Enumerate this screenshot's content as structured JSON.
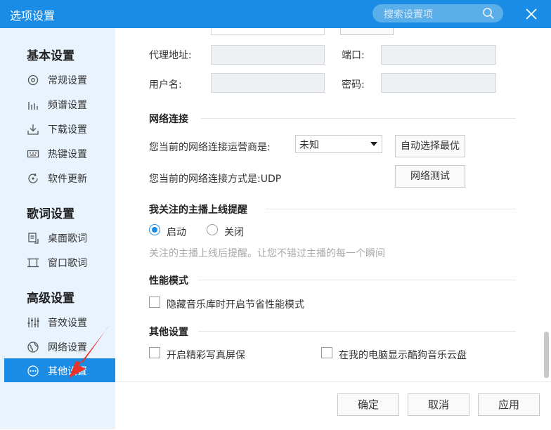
{
  "window": {
    "title": "选项设置"
  },
  "search": {
    "placeholder": "搜索设置项"
  },
  "sidebar": {
    "basic": {
      "heading": "基本设置",
      "items": [
        {
          "label": "常规设置",
          "icon": "gear-icon"
        },
        {
          "label": "频谱设置",
          "icon": "spectrum-icon"
        },
        {
          "label": "下载设置",
          "icon": "download-icon"
        },
        {
          "label": "热键设置",
          "icon": "keyboard-icon"
        },
        {
          "label": "软件更新",
          "icon": "update-icon"
        }
      ]
    },
    "lyrics": {
      "heading": "歌词设置",
      "items": [
        {
          "label": "桌面歌词",
          "icon": "desktop-lyrics-icon"
        },
        {
          "label": "窗口歌词",
          "icon": "window-lyrics-icon"
        }
      ]
    },
    "advanced": {
      "heading": "高级设置",
      "items": [
        {
          "label": "音效设置",
          "icon": "equalizer-icon"
        },
        {
          "label": "网络设置",
          "icon": "network-icon"
        },
        {
          "label": "其他设置",
          "icon": "more-icon"
        }
      ]
    },
    "active": "其他设置"
  },
  "proxy": {
    "address_label": "代理地址:",
    "port_label": "端口:",
    "username_label": "用户名:",
    "password_label": "密码:"
  },
  "network": {
    "title": "网络连接",
    "isp_label": "您当前的网络连接运营商是:",
    "isp_value": "未知",
    "auto_button": "自动选择最优",
    "method_label": "您当前的网络连接方式是:UDP",
    "test_button": "网络测试"
  },
  "anchor": {
    "title": "我关注的主播上线提醒",
    "on_label": "启动",
    "off_label": "关闭",
    "hint": "关注的主播上线后提醒。让您不错过主播的每一个瞬间"
  },
  "performance": {
    "title": "性能模式",
    "hide_label": "隐藏音乐库时开启节省性能模式"
  },
  "other": {
    "title": "其他设置",
    "screensaver_label": "开启精彩写真屏保",
    "cloud_label": "在我的电脑显示酷狗音乐云盘"
  },
  "footer": {
    "ok": "确定",
    "cancel": "取消",
    "apply": "应用"
  },
  "colors": {
    "accent": "#1a8ce6",
    "sidebar_bg": "#e8f3fd",
    "annotation": "#e8332b"
  }
}
